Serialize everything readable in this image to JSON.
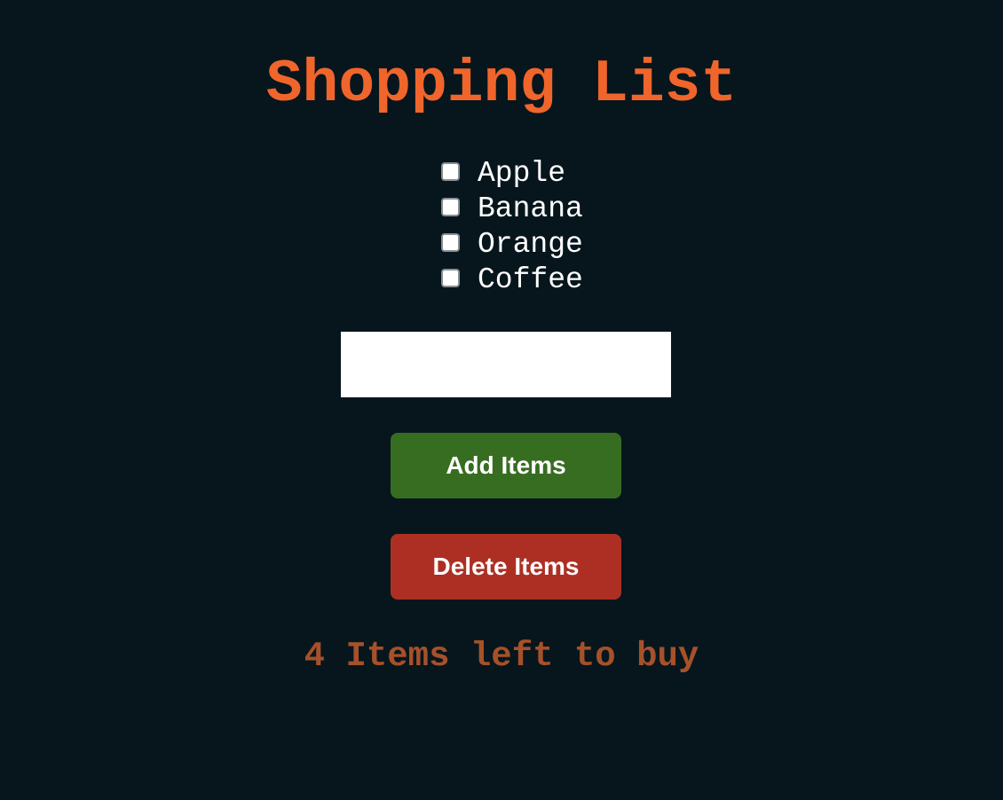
{
  "header": {
    "title": "Shopping List"
  },
  "list": {
    "items": [
      {
        "label": "Apple",
        "checked": false
      },
      {
        "label": "Banana",
        "checked": false
      },
      {
        "label": "Orange",
        "checked": false
      },
      {
        "label": "Coffee",
        "checked": false
      }
    ]
  },
  "input": {
    "value": "",
    "placeholder": ""
  },
  "buttons": {
    "add_label": "Add Items",
    "delete_label": "Delete Items"
  },
  "status": {
    "text": "4 Items left to buy"
  },
  "colors": {
    "background": "#07161d",
    "title": "#f0652b",
    "add_button": "#376d21",
    "delete_button": "#ad2f24",
    "status_text": "#a65129"
  }
}
